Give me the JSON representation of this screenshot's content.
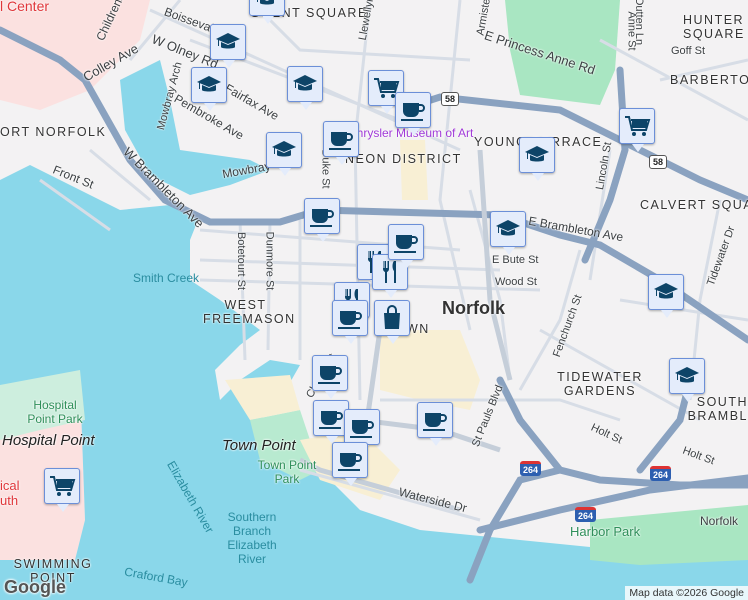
{
  "map": {
    "attribution": "Map data ©2026 Google",
    "logo": "Google",
    "colors": {
      "water": "#8ad7ea",
      "land": "#f3f2f3",
      "park": "#a9e6c2",
      "road_major": "#8aa2c0",
      "road_minor": "#d7dde6",
      "medical": "#fbe1e0",
      "downtown": "#f8efd4",
      "marker_bg": "#e4ecfb",
      "marker_icon": "#0d4468"
    },
    "city_label": "Norfolk",
    "neighborhoods": [
      "GHENT SQUARE",
      "HUNTER SQUARE",
      "BARBERTON",
      "ORT NORFOLK",
      "NEON DISTRICT",
      "YOUNG TERRACE",
      "CALVERT SQUA",
      "WEST FREEMASON",
      "TIDEWATER GARDENS",
      "SOUTH BRAMBL",
      "SWIMMING POINT",
      "WN"
    ],
    "streets": [
      "Boissevain",
      "W Olney Rd",
      "Colley Ave",
      "Childrens",
      "Mowbray Arch",
      "Pembroke Ave",
      "Fairfax Ave",
      "Mowbray",
      "Front St",
      "W Brambleton Ave",
      "Botetourt St",
      "Dunmore St",
      "Duke St",
      "Llewellyn",
      "Armistead",
      "E Princess Anne Rd",
      "Outten Ln",
      "Anne St",
      "Goff St",
      "E Brambleton Ave",
      "E Bute St",
      "Wood St",
      "Lincoln St",
      "Fenchurch St",
      "Tidewater Dr",
      "St Pauls Blvd",
      "Holt St",
      "Holt St",
      "Waterside Dr",
      "Church St"
    ],
    "water_labels": [
      "Smith Creek",
      "Elizabeth River",
      "Southern Branch Elizabeth River",
      "Craford Bay"
    ],
    "park_labels": [
      "Hospital Point Park",
      "Town Point Park",
      "Harbor Park"
    ],
    "place_labels": [
      "Hospital Point",
      "Town Point"
    ],
    "poi_labels": [
      "Chrysler Museum of Art",
      "Norfolk"
    ],
    "medical_labels": [
      "l Center",
      "ical",
      "uth"
    ],
    "route_shields": [
      "58",
      "58",
      "264",
      "264",
      "264"
    ],
    "markers": [
      {
        "type": "school",
        "icon": "graduation-cap-icon"
      },
      {
        "type": "school",
        "icon": "graduation-cap-icon"
      },
      {
        "type": "school",
        "icon": "graduation-cap-icon"
      },
      {
        "type": "school",
        "icon": "graduation-cap-icon"
      },
      {
        "type": "school",
        "icon": "graduation-cap-icon"
      },
      {
        "type": "school",
        "icon": "graduation-cap-icon"
      },
      {
        "type": "school",
        "icon": "graduation-cap-icon"
      },
      {
        "type": "school",
        "icon": "graduation-cap-icon"
      },
      {
        "type": "school",
        "icon": "graduation-cap-icon"
      },
      {
        "type": "grocery",
        "icon": "shopping-cart-icon"
      },
      {
        "type": "grocery",
        "icon": "shopping-cart-icon"
      },
      {
        "type": "grocery",
        "icon": "shopping-cart-icon"
      },
      {
        "type": "restaurant",
        "icon": "fork-knife-icon"
      },
      {
        "type": "restaurant",
        "icon": "fork-knife-icon"
      },
      {
        "type": "restaurant",
        "icon": "fork-knife-icon"
      },
      {
        "type": "shopping",
        "icon": "shopping-bag-icon"
      },
      {
        "type": "cafe",
        "icon": "coffee-cup-icon"
      },
      {
        "type": "cafe",
        "icon": "coffee-cup-icon"
      },
      {
        "type": "cafe",
        "icon": "coffee-cup-icon"
      },
      {
        "type": "cafe",
        "icon": "coffee-cup-icon"
      },
      {
        "type": "cafe",
        "icon": "coffee-cup-icon"
      },
      {
        "type": "cafe",
        "icon": "coffee-cup-icon"
      },
      {
        "type": "cafe",
        "icon": "coffee-cup-icon"
      },
      {
        "type": "cafe",
        "icon": "coffee-cup-icon"
      },
      {
        "type": "cafe",
        "icon": "coffee-cup-icon"
      },
      {
        "type": "cafe",
        "icon": "coffee-cup-icon"
      }
    ]
  }
}
